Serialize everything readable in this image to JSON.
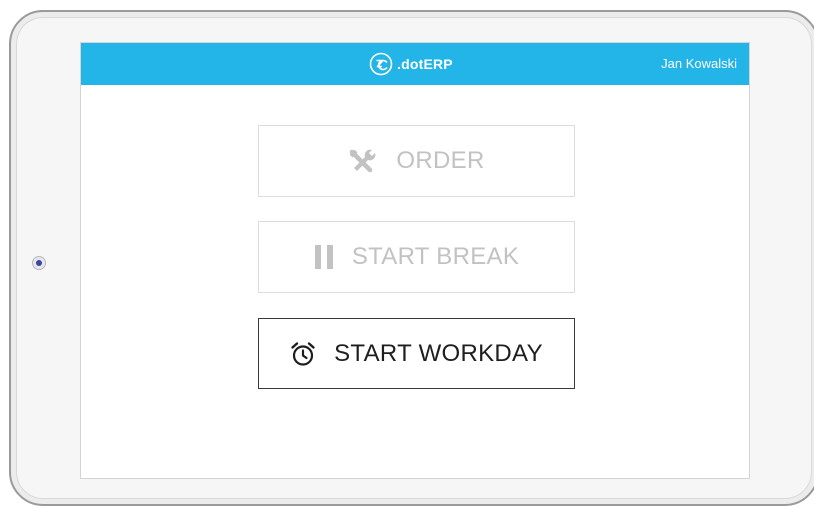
{
  "app": {
    "brand_name": ".dotERP",
    "user_name": "Jan Kowalski",
    "accent_color": "#23b4e8"
  },
  "actions": [
    {
      "label": "ORDER",
      "icon": "tools-icon",
      "enabled": false
    },
    {
      "label": "START BREAK",
      "icon": "pause-icon",
      "enabled": false
    },
    {
      "label": "START WORKDAY",
      "icon": "alarm-clock-icon",
      "enabled": true
    }
  ]
}
